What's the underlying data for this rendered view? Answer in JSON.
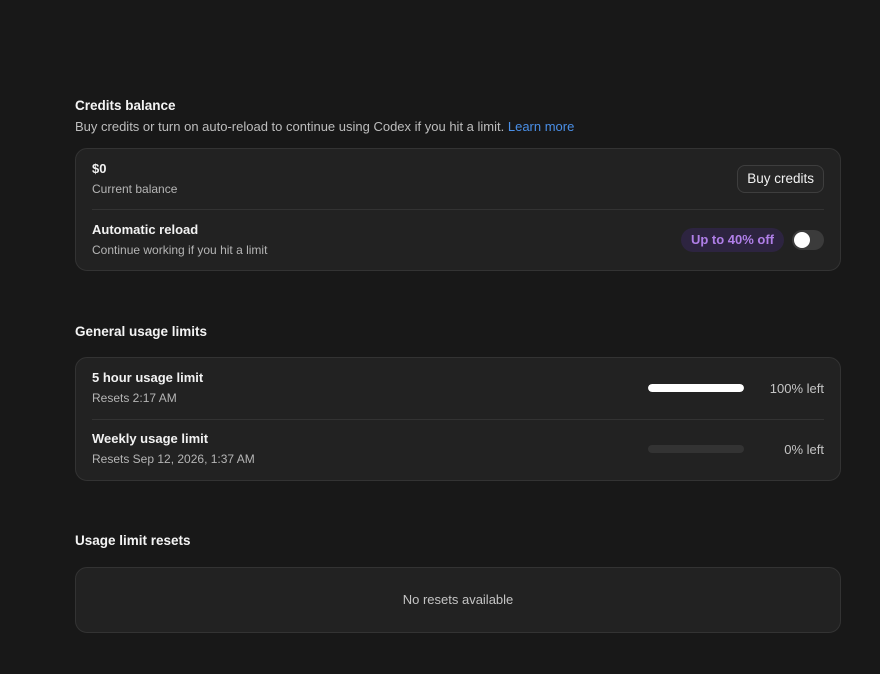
{
  "credits": {
    "title": "Credits balance",
    "subtitle": "Buy credits or turn on auto-reload to continue using Codex if you hit a limit.",
    "learn_more": "Learn more",
    "balance": {
      "value": "$0",
      "label": "Current balance",
      "button": "Buy credits"
    },
    "auto_reload": {
      "title": "Automatic reload",
      "subtitle": "Continue working if you hit a limit",
      "promo": "Up to 40% off",
      "enabled": false
    }
  },
  "usage": {
    "title": "General usage limits",
    "limits": [
      {
        "name": "5 hour usage limit",
        "reset": "Resets 2:17 AM",
        "remaining_fraction": 1.0,
        "remaining_label": "100% left"
      },
      {
        "name": "Weekly usage limit",
        "reset": "Resets Sep 12, 2026, 1:37 AM",
        "remaining_fraction": 0.0,
        "remaining_label": "0% left"
      }
    ]
  },
  "resets": {
    "title": "Usage limit resets",
    "empty": "No resets available"
  },
  "colors": {
    "background": "#181818",
    "card": "#222222",
    "accent_link": "#4a8fe7",
    "promo_text": "#b07fe8",
    "promo_bg": "#2d2440"
  }
}
